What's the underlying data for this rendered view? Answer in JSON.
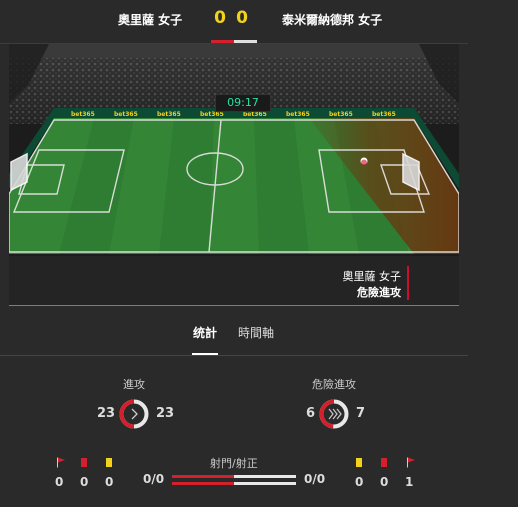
{
  "header": {
    "home_team": "奧里薩 女子",
    "home_score": "0",
    "away_score": "0",
    "away_team": "泰米爾納德邦 女子"
  },
  "pitch": {
    "clock": "09:17",
    "sponsor": "bet365",
    "event_team": "奧里薩 女子",
    "event_action": "危險進攻"
  },
  "tabs": {
    "stats": "统計",
    "timeline": "時間軸"
  },
  "stats": {
    "attacks_label": "進攻",
    "attacks_home": "23",
    "attacks_away": "23",
    "dangerous_label": "危險進攻",
    "dangerous_home": "6",
    "dangerous_away": "7",
    "home_corners": "0",
    "home_red": "0",
    "home_yellow": "0",
    "shots_label": "射門/射正",
    "shots_home": "0/0",
    "shots_away": "0/0",
    "away_yellow": "0",
    "away_red": "0",
    "away_corners": "1"
  },
  "colors": {
    "accent_red": "#d4202c",
    "score_yellow": "#f3d21b",
    "clock_green": "#27e0a0",
    "card_yellow": "#f2d21b",
    "card_red": "#d4202c"
  }
}
